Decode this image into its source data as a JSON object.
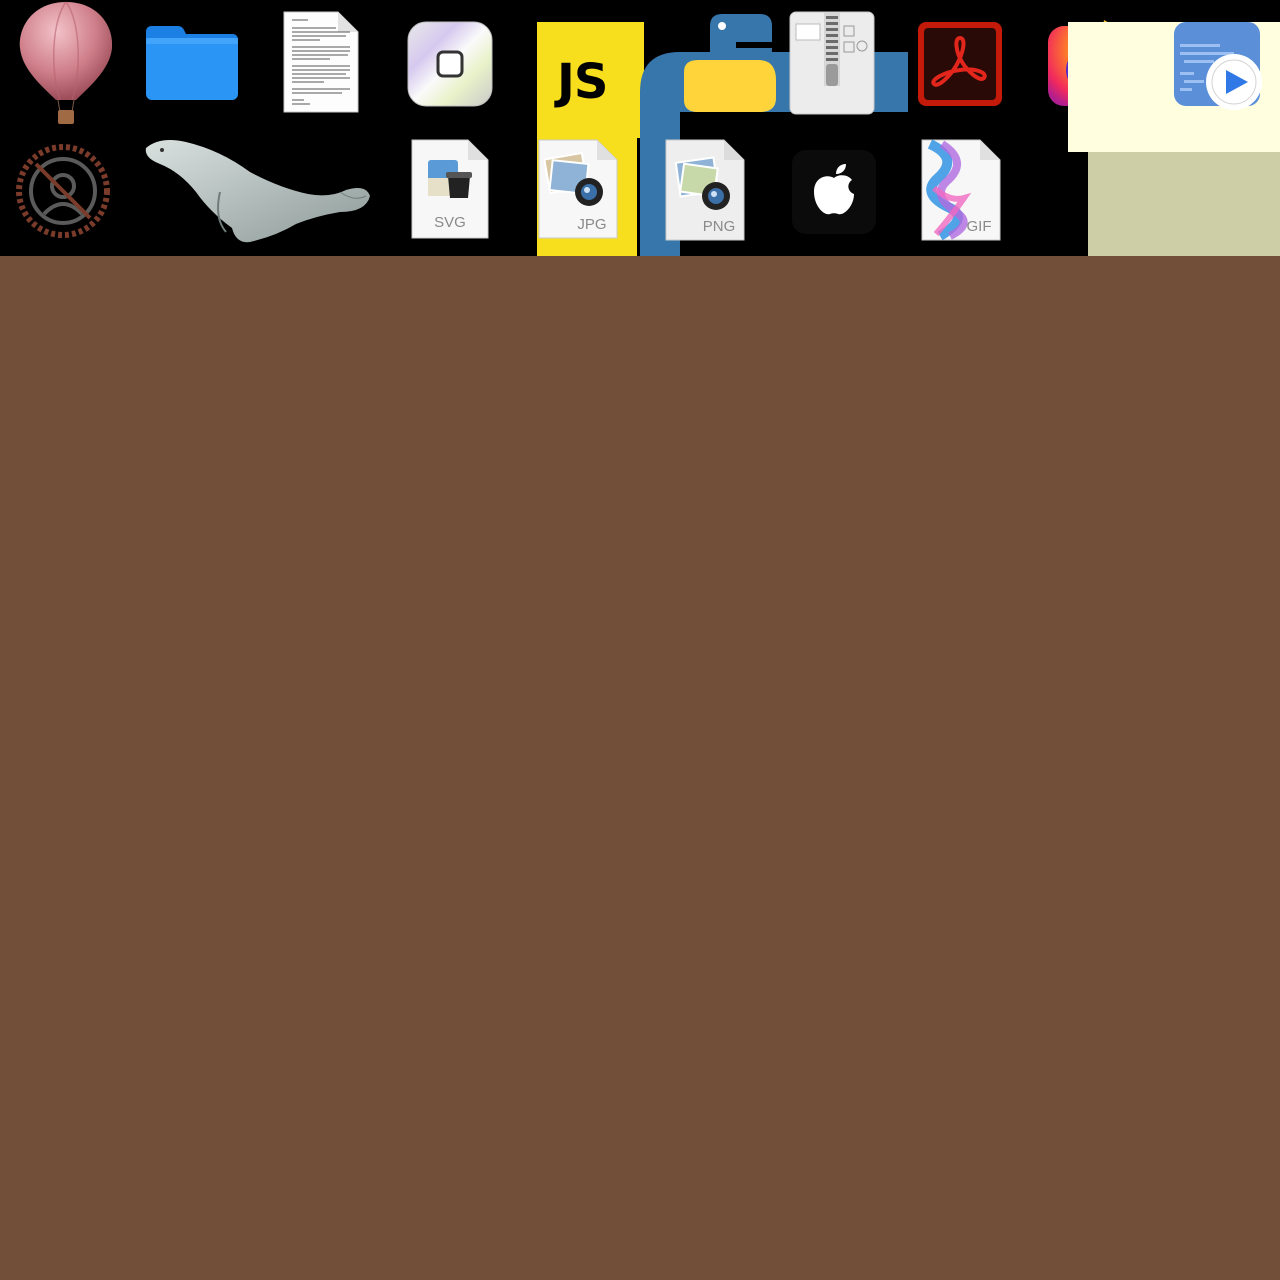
{
  "desktop": {
    "background_color": "#714f38",
    "icons": [
      {
        "id": "hot-air-balloon",
        "icon": "hot-air-balloon-icon"
      },
      {
        "id": "folder",
        "icon": "folder-icon",
        "color": "#1e8bf5"
      },
      {
        "id": "text-document",
        "icon": "text-document-icon"
      },
      {
        "id": "disc-image",
        "icon": "disc-icon"
      },
      {
        "id": "javascript",
        "icon": "javascript-icon",
        "label": "JS",
        "color": "#f7df1e"
      },
      {
        "id": "python",
        "icon": "python-icon",
        "colors": [
          "#3776ab",
          "#ffd43b"
        ]
      },
      {
        "id": "zip-archive",
        "icon": "zip-archive-icon"
      },
      {
        "id": "adobe-acrobat",
        "icon": "acrobat-icon",
        "color": "#c41a0a"
      },
      {
        "id": "firefox",
        "icon": "firefox-icon"
      },
      {
        "id": "script-editor",
        "icon": "script-play-icon"
      },
      {
        "id": "badge",
        "icon": "gear-badge-icon"
      },
      {
        "id": "manatee",
        "icon": "manatee-icon"
      },
      {
        "id": "svg-file",
        "icon": "svg-file-icon",
        "label": "SVG"
      },
      {
        "id": "jpg-file",
        "icon": "jpg-file-icon",
        "label": "JPG"
      },
      {
        "id": "png-file",
        "icon": "png-file-icon",
        "label": "PNG"
      },
      {
        "id": "apple",
        "icon": "apple-logo-icon"
      },
      {
        "id": "gif-file",
        "icon": "gif-file-icon",
        "label": "GIF"
      }
    ]
  }
}
